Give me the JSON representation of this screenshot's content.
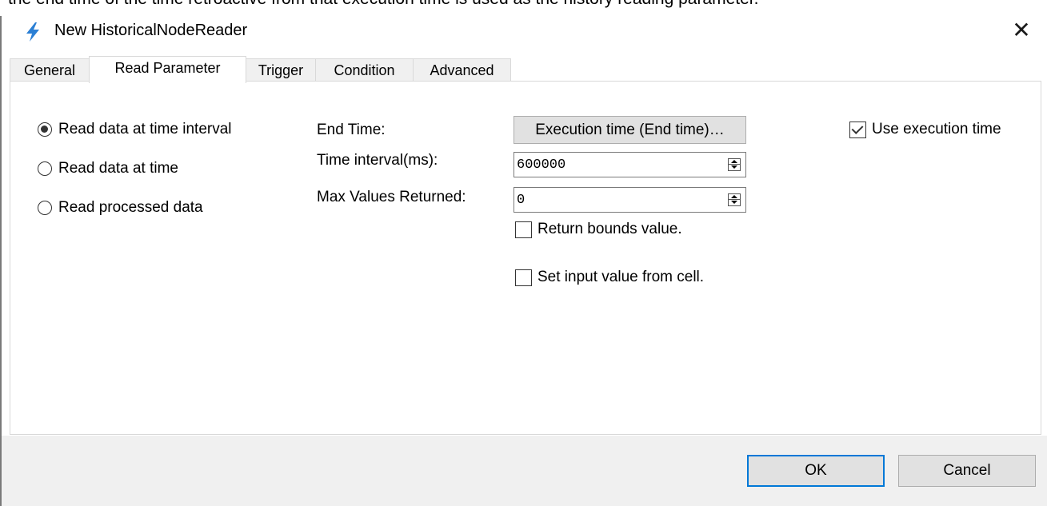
{
  "doc_text": "the end time of the time retroactive from that execution time is used as the history reading parameter.",
  "dialog": {
    "title": "New HistoricalNodeReader",
    "close_glyph": "✕",
    "title_icon": "lightning-icon",
    "accent_color": "#0078d7"
  },
  "tabs": [
    {
      "label": "General"
    },
    {
      "label": "Read Parameter"
    },
    {
      "label": "Trigger"
    },
    {
      "label": "Condition"
    },
    {
      "label": "Advanced"
    }
  ],
  "read_mode": {
    "options": [
      {
        "label": "Read data at time interval",
        "checked": true
      },
      {
        "label": "Read data at time",
        "checked": false
      },
      {
        "label": "Read processed data",
        "checked": false
      }
    ]
  },
  "params": {
    "end_time_label": "End Time:",
    "end_time_button": "Execution time (End time)…",
    "use_execution_time_label": "Use execution time",
    "use_execution_time_checked": true,
    "time_interval_label": "Time interval(ms):",
    "time_interval_value": "600000",
    "max_values_label": "Max Values Returned:",
    "max_values_value": "0",
    "return_bounds_label": "Return bounds value.",
    "return_bounds_checked": false,
    "set_input_label": "Set input value from cell.",
    "set_input_checked": false
  },
  "footer": {
    "ok_label": "OK",
    "cancel_label": "Cancel"
  }
}
